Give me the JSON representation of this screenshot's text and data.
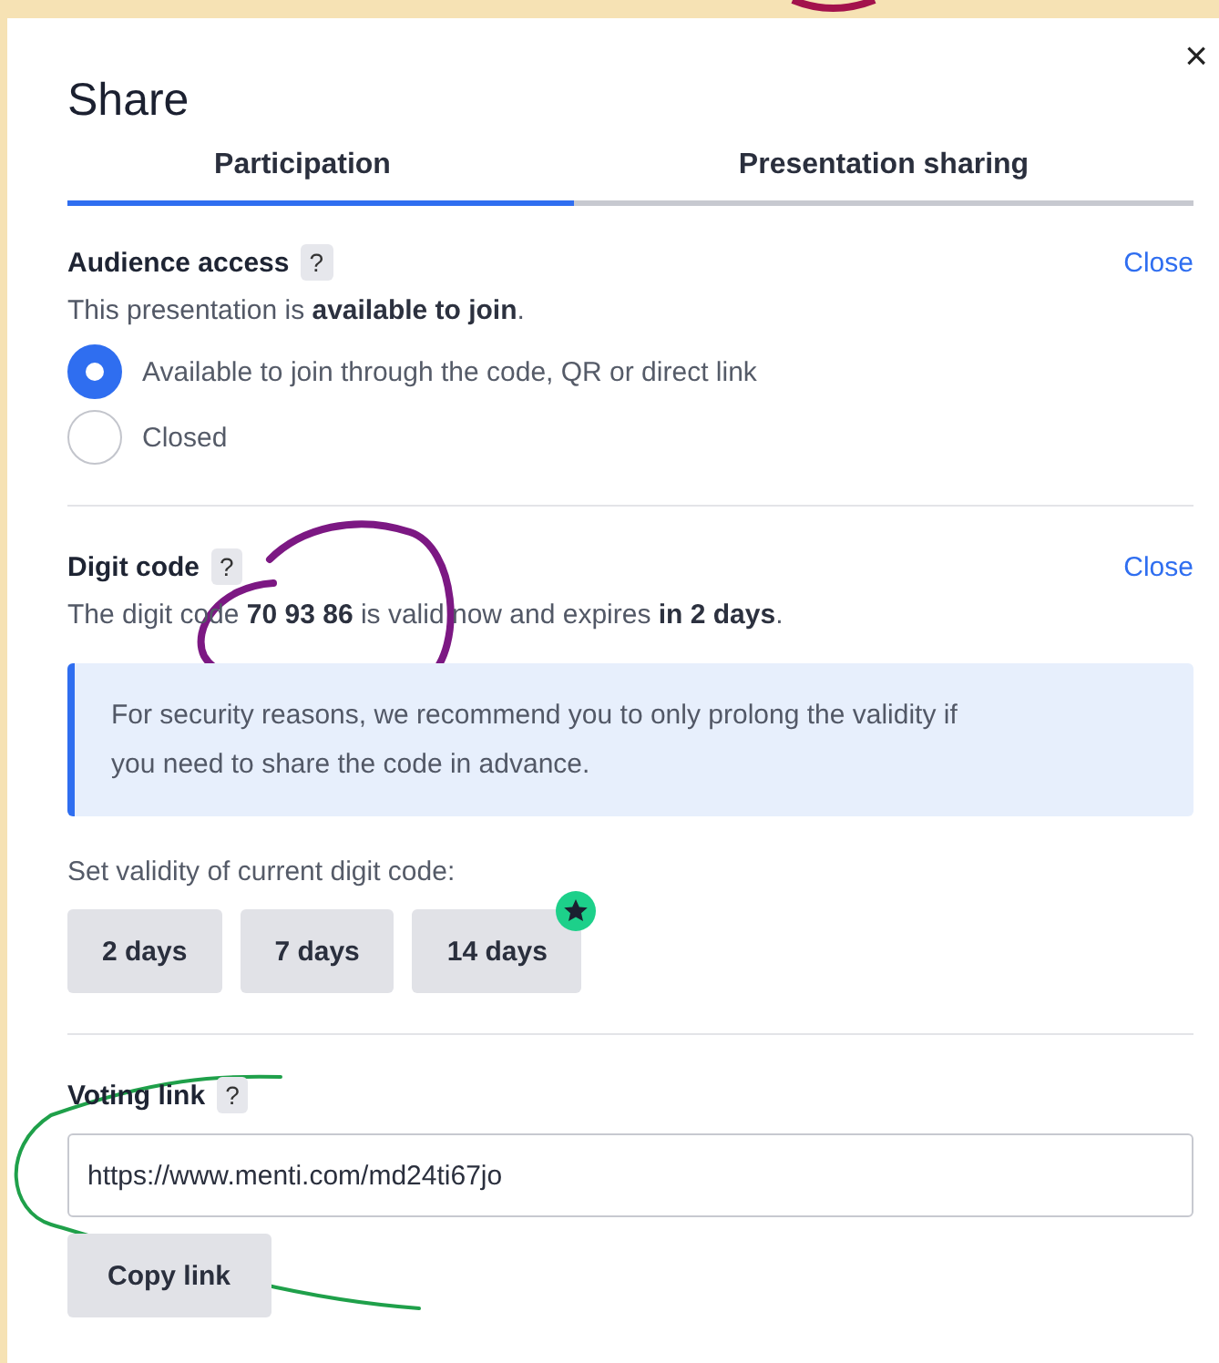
{
  "dialog": {
    "title": "Share",
    "close_icon": "×"
  },
  "tabs": [
    {
      "label": "Participation",
      "selected": true
    },
    {
      "label": "Presentation sharing",
      "selected": false
    }
  ],
  "sections": [
    {
      "kind": "access",
      "heading": "Audience access",
      "help": "?",
      "action": "Close",
      "description": "This presentation is **available to join**.",
      "options": [
        {
          "label": "Available to join through the code, QR or direct link",
          "selected": true
        },
        {
          "label": "Closed",
          "selected": false
        }
      ]
    },
    {
      "kind": "code",
      "heading": "Digit code",
      "help": "?",
      "action": "Close",
      "description": "The digit code **70 93 86** is valid now and expires **in 2 days**.",
      "notice": "For security reasons, we recommend you to only prolong the validity if you need to share the code in advance.",
      "validity_label": "Set validity of current digit code:",
      "validity_buttons": [
        {
          "label": "2 days",
          "premium": false
        },
        {
          "label": "7 days",
          "premium": false
        },
        {
          "label": "14 days",
          "premium": true
        }
      ]
    },
    {
      "kind": "link",
      "heading": "Voting link",
      "help": "?",
      "value": "https://www.menti.com/md24ti67jo",
      "button": "Copy link"
    }
  ]
}
